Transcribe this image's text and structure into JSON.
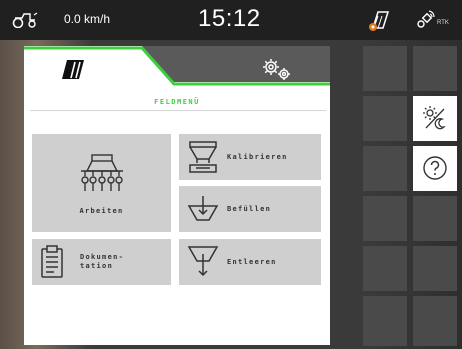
{
  "status_bar": {
    "speed": "0.0 km/h",
    "time": "15:12",
    "rtk_label": "RTK",
    "icons": [
      "tractor-icon",
      "implement-icon",
      "gps-rtk-icon"
    ]
  },
  "tabs": [
    {
      "name": "field-menu",
      "icon": "field-icon",
      "active": true
    },
    {
      "name": "settings",
      "icon": "gears-icon",
      "active": false
    }
  ],
  "menu": {
    "title": "FELDMENÜ",
    "tiles": [
      {
        "id": "arbeiten",
        "label": "Arbeiten",
        "icon": "spreader-icon"
      },
      {
        "id": "kalibrieren",
        "label": "Kalibrieren",
        "icon": "calibrate-hopper-icon"
      },
      {
        "id": "befuellen",
        "label": "Befüllen",
        "icon": "fill-hopper-icon"
      },
      {
        "id": "dokumentation",
        "label": "Dokumen-\ntation",
        "icon": "clipboard-icon"
      },
      {
        "id": "entleeren",
        "label": "Entleeren",
        "icon": "empty-hopper-icon"
      }
    ]
  },
  "side_panel": {
    "buttons": [
      "day-night-icon",
      "help-icon"
    ]
  },
  "colors": {
    "accent_green": "#3ecf3e",
    "tile_gray": "#cfcfcf",
    "tab_gray": "#5a5a5a"
  }
}
